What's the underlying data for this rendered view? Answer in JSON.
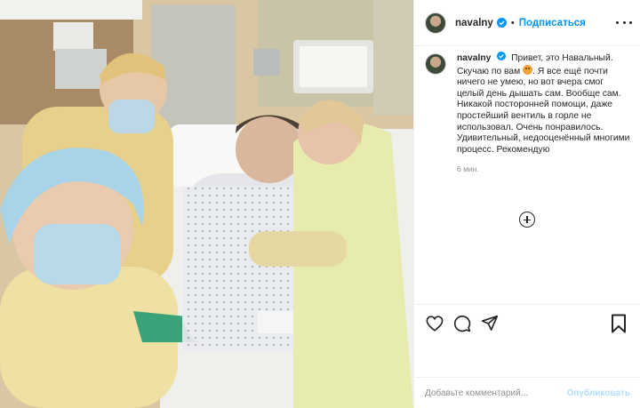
{
  "photo": {
    "icon": "hospital-selfie-photo"
  },
  "header": {
    "username": "navalny",
    "follow_label": "Подписаться"
  },
  "caption": {
    "username": "navalny",
    "text_before_emoji": "Привет, это Навальный. Скучаю по вам",
    "text_after_emoji": ". Я все ещё почти ничего не умею, но вот вчера смог целый день дышать сам. Вообще сам. Никакой посторонней помощи, даже простейший вентиль в горле не использовал. Очень понравилось. Удивительный, недооценённый многими процесс. Рекомендую",
    "time": "6 мин."
  },
  "comment": {
    "placeholder": "Добавьте комментарий...",
    "publish_label": "Опубликовать"
  },
  "colors": {
    "accent": "#0095f6",
    "publish_disabled": "#b2dffc",
    "text": "#262626",
    "muted": "#8e8e8e",
    "border": "#efefef"
  }
}
